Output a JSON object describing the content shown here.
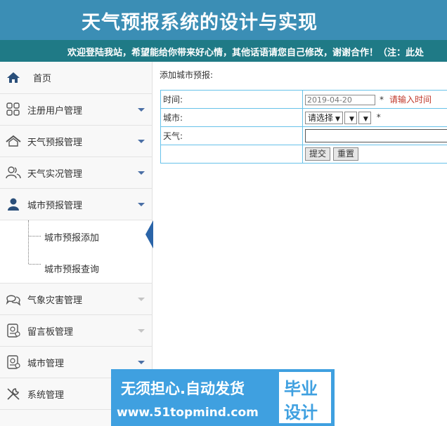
{
  "header": {
    "title": "天气预报系统的设计与实现",
    "marquee": "欢迎登陆我站，希望能给你带来好心情，其他话语请您自己修改，谢谢合作！（注：此处"
  },
  "sidebar": {
    "items": [
      {
        "label": "首页",
        "icon": "home-icon"
      },
      {
        "label": "注册用户管理",
        "icon": "grid-icon"
      },
      {
        "label": "天气预报管理",
        "icon": "roof-icon"
      },
      {
        "label": "天气实况管理",
        "icon": "users-icon"
      },
      {
        "label": "城市预报管理",
        "icon": "user-icon"
      },
      {
        "label": "气象灾害管理",
        "icon": "chat-icon"
      },
      {
        "label": "留言板管理",
        "icon": "document-icon"
      },
      {
        "label": "城市管理",
        "icon": "document-icon"
      },
      {
        "label": "系统管理",
        "icon": "tools-icon"
      }
    ],
    "submenu": [
      {
        "label": "城市预报添加"
      },
      {
        "label": "城市预报查询"
      }
    ]
  },
  "content": {
    "heading": "添加城市预报:",
    "rows": {
      "time_label": "时间:",
      "time_value": "2019-04-20",
      "time_star": "*",
      "time_hint": "请输入时间",
      "city_label": "城市:",
      "city_select1": "请选择",
      "city_select2": "",
      "city_select3": "",
      "city_star": "*",
      "weather_label": "天气:"
    },
    "buttons": {
      "submit": "提交",
      "reset": "重置"
    }
  },
  "watermark": {
    "line1": "无须担心.自动发货",
    "line2": "www.51topmind.com",
    "box_top": "毕业",
    "box_bottom": "设计"
  },
  "colors": {
    "header_bg": "#3b8eb5",
    "marquee_bg": "#1f7a86",
    "table_border": "#67c2ea",
    "active_arrow": "#2a64a8",
    "hint_red": "#c0392b",
    "watermark_bg": "#3fa0e0"
  }
}
